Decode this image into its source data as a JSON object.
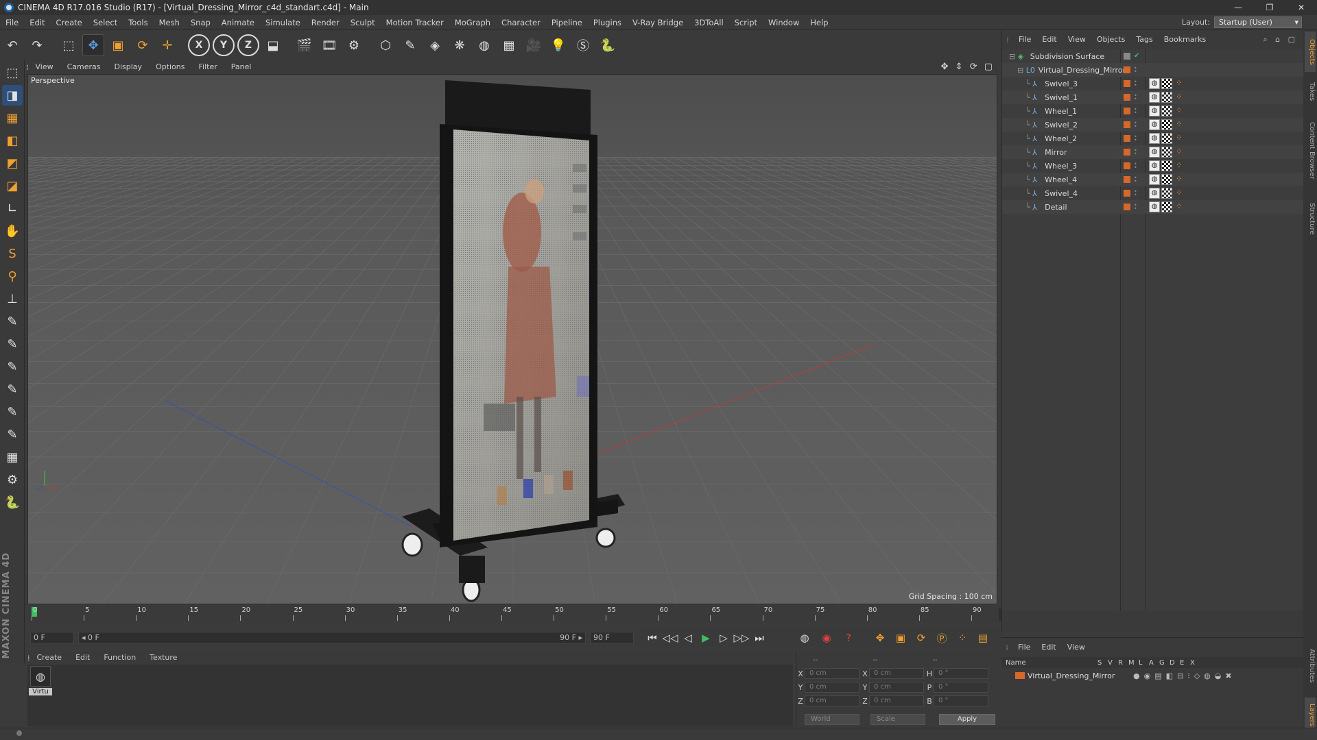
{
  "window": {
    "title": "CINEMA 4D R17.016 Studio (R17) - [Virtual_Dressing_Mirror_c4d_standart.c4d] - Main",
    "layout_label": "Layout:",
    "layout_value": "Startup (User)"
  },
  "menu": [
    "File",
    "Edit",
    "Create",
    "Select",
    "Tools",
    "Mesh",
    "Snap",
    "Animate",
    "Simulate",
    "Render",
    "Sculpt",
    "Motion Tracker",
    "MoGraph",
    "Character",
    "Pipeline",
    "Plugins",
    "V-Ray Bridge",
    "3DToAll",
    "Script",
    "Window",
    "Help"
  ],
  "toolbar_icons": [
    "undo-icon",
    "redo-icon",
    "live-selection-icon",
    "move-icon",
    "scale-icon",
    "rotate-icon",
    "last-tool-icon",
    "x-axis-icon",
    "y-axis-icon",
    "z-axis-icon",
    "world-coord-icon",
    "render-view-icon",
    "render-picture-viewer-icon",
    "edit-render-settings-icon",
    "cube-icon",
    "pen-spline-icon",
    "subdivision-surface-icon",
    "array-icon",
    "deformer-icon",
    "floor-icon",
    "camera-icon",
    "light-icon",
    "sketch-icon",
    "python-icon"
  ],
  "toolbar_glyphs": [
    "↶",
    "↷",
    "⬚",
    "✥",
    "▣",
    "⟳",
    "✛",
    "X",
    "Y",
    "Z",
    "⬓",
    "🎬",
    "🎞",
    "⚙",
    "⬡",
    "✎",
    "◈",
    "❋",
    "◍",
    "▦",
    "🎥",
    "💡",
    "Ⓢ",
    "🐍"
  ],
  "left_tools": [
    "⬚",
    "◨",
    "▦",
    "◧",
    "◩",
    "◪",
    "∟",
    "✋",
    "S",
    "⚲",
    "⊥",
    "✎",
    "✎",
    "✎",
    "✎",
    "✎",
    "✎",
    "▦",
    "⚙",
    "🐍"
  ],
  "viewport": {
    "menu": [
      "View",
      "Cameras",
      "Display",
      "Options",
      "Filter",
      "Panel"
    ],
    "label": "Perspective",
    "grid_spacing": "Grid Spacing : 100 cm",
    "nav_icons": "✥ ⇕ ⟳ ▢"
  },
  "timeline": {
    "ticks": [
      "0",
      "5",
      "10",
      "15",
      "20",
      "25",
      "30",
      "35",
      "40",
      "45",
      "50",
      "55",
      "60",
      "65",
      "70",
      "75",
      "80",
      "85",
      "90"
    ],
    "current_frame": "0 F",
    "end_frame_display": "0 F"
  },
  "playback": {
    "start_field": "0 F",
    "range_start": "◂ 0 F",
    "range_end": "90 F ▸",
    "end_field": "90 F",
    "buttons": [
      "⏮",
      "◁◁",
      "◁",
      "▶",
      "▷",
      "▷▷",
      "⏭"
    ]
  },
  "materials": {
    "menu": [
      "Create",
      "Edit",
      "Function",
      "Texture"
    ],
    "items": [
      {
        "label": "Virtu"
      }
    ]
  },
  "coordinates": {
    "headers": [
      "--",
      "--",
      "--"
    ],
    "rows": [
      {
        "l1": "X",
        "v1": "0 cm",
        "l2": "X",
        "v2": "0 cm",
        "l3": "H",
        "v3": "0 °"
      },
      {
        "l1": "Y",
        "v1": "0 cm",
        "l2": "Y",
        "v2": "0 cm",
        "l3": "P",
        "v3": "0 °"
      },
      {
        "l1": "Z",
        "v1": "0 cm",
        "l2": "Z",
        "v2": "0 cm",
        "l3": "B",
        "v3": "0 °"
      }
    ],
    "mode": "World",
    "transform": "Scale",
    "apply": "Apply"
  },
  "object_manager": {
    "menu": [
      "File",
      "Edit",
      "View",
      "Objects",
      "Tags",
      "Bookmarks"
    ],
    "objects": [
      {
        "name": "Subdivision Surface",
        "indent": 0,
        "icon": "◈"
      },
      {
        "name": "Virtual_Dressing_Mirror",
        "indent": 1,
        "icon": "L0"
      },
      {
        "name": "Swivel_3",
        "indent": 2,
        "icon": "⅄"
      },
      {
        "name": "Swivel_1",
        "indent": 2,
        "icon": "⅄"
      },
      {
        "name": "Wheel_1",
        "indent": 2,
        "icon": "⅄"
      },
      {
        "name": "Swivel_2",
        "indent": 2,
        "icon": "⅄"
      },
      {
        "name": "Wheel_2",
        "indent": 2,
        "icon": "⅄"
      },
      {
        "name": "Mirror",
        "indent": 2,
        "icon": "⅄"
      },
      {
        "name": "Wheel_3",
        "indent": 2,
        "icon": "⅄"
      },
      {
        "name": "Wheel_4",
        "indent": 2,
        "icon": "⅄"
      },
      {
        "name": "Swivel_4",
        "indent": 2,
        "icon": "⅄"
      },
      {
        "name": "Detail",
        "indent": 2,
        "icon": "⅄"
      }
    ]
  },
  "side_tabs": [
    "Objects",
    "Takes",
    "Content Browser",
    "Structure"
  ],
  "side_tabs_bottom": [
    "Attributes",
    "Layers"
  ],
  "layers": {
    "menu": [
      "File",
      "Edit",
      "View"
    ],
    "columns": [
      "Name",
      "S",
      "V",
      "R",
      "M",
      "L",
      "A",
      "G",
      "D",
      "E",
      "X"
    ],
    "rows": [
      {
        "name": "Virtual_Dressing_Mirror"
      }
    ]
  },
  "colors": {
    "accent_orange": "#d8672a",
    "selection_blue": "#2d4f7a"
  }
}
